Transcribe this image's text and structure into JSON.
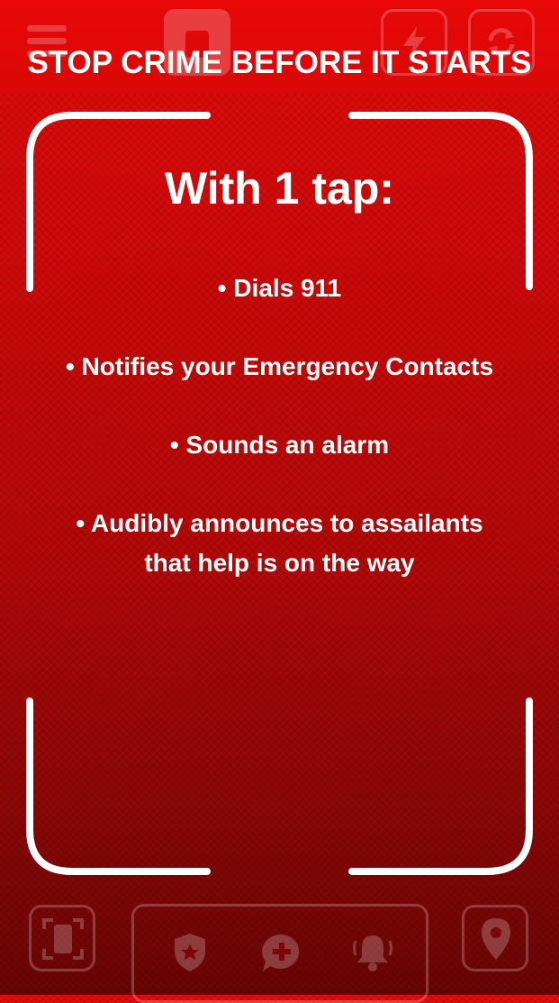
{
  "banner": {
    "title": "STOP CRIME BEFORE IT STARTS"
  },
  "card": {
    "heading": "With 1 tap:",
    "bullets": [
      "• Dials 911",
      "• Notifies your Emergency Contacts",
      "• Sounds an alarm",
      "• Audibly announces to assailants"
    ],
    "bullet_4_line_2": "that help is on the way"
  },
  "icons": {
    "top": [
      "menu-icon",
      "app-logo-icon",
      "flash-icon",
      "refresh-icon"
    ],
    "bottom": [
      "scan-phone-icon",
      "police-shield-icon",
      "medical-chat-icon",
      "alarm-bell-icon",
      "location-pin-icon"
    ]
  },
  "colors": {
    "accent": "#e20c0c",
    "dark": "#6a0505",
    "text": "#ffffff"
  }
}
